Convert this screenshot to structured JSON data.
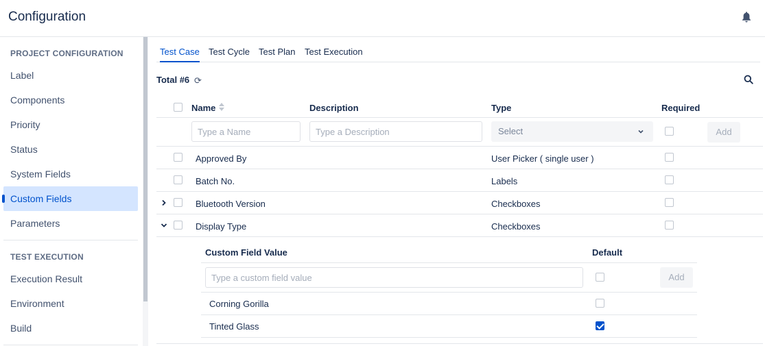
{
  "header": {
    "title": "Configuration",
    "bell_icon": "bell-icon"
  },
  "sidebar": {
    "sections": [
      {
        "title": "PROJECT CONFIGURATION",
        "items": [
          "Label",
          "Components",
          "Priority",
          "Status",
          "System Fields",
          "Custom Fields",
          "Parameters"
        ]
      },
      {
        "title": "TEST EXECUTION",
        "items": [
          "Execution Result",
          "Environment",
          "Build"
        ]
      }
    ],
    "active_item": "Custom Fields"
  },
  "tabs": {
    "items": [
      "Test Case",
      "Test Cycle",
      "Test Plan",
      "Test Execution"
    ],
    "active": "Test Case"
  },
  "summary": {
    "total_label": "Total #6",
    "refresh_icon": "refresh-icon",
    "search_icon": "search-icon"
  },
  "table": {
    "columns": {
      "name": "Name",
      "description": "Description",
      "type": "Type",
      "required": "Required"
    },
    "new_row": {
      "name_placeholder": "Type a Name",
      "description_placeholder": "Type a Description",
      "type_value": "Select",
      "add_label": "Add"
    },
    "rows": [
      {
        "name": "Approved By",
        "type": "User Picker ( single user )",
        "required": false
      },
      {
        "name": "Batch No.",
        "type": "Labels",
        "required": false
      },
      {
        "name": "Bluetooth Version",
        "type": "Checkboxes",
        "required": false,
        "expander": "collapsed"
      },
      {
        "name": "Display Type",
        "type": "Checkboxes",
        "required": false,
        "expander": "expanded"
      }
    ]
  },
  "subtable": {
    "columns": {
      "value": "Custom Field Value",
      "default": "Default"
    },
    "new_row": {
      "value_placeholder": "Type a custom field value",
      "add_label": "Add"
    },
    "rows": [
      {
        "value": "Corning Gorilla",
        "default": false
      },
      {
        "value": "Tinted Glass",
        "default": true
      }
    ]
  },
  "colors": {
    "accent": "#0052cc",
    "active_bg": "#d4e5ff",
    "text": "#172b4d"
  }
}
